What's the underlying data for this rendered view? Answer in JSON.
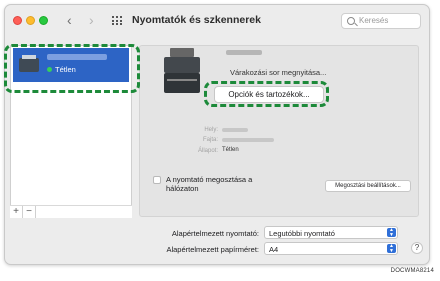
{
  "window": {
    "title": "Nyomtatók és szkennerek",
    "search_placeholder": "Keresés"
  },
  "sidebar": {
    "items": [
      {
        "status": "Tétlen"
      }
    ],
    "add_label": "+",
    "remove_label": "−"
  },
  "detail": {
    "queue_text": "Várakozási sor megnyitása...",
    "options_button": "Opciók és tartozékok...",
    "location_label": "Hely:",
    "kind_label": "Fajta:",
    "status_label": "Állapot:",
    "status_value": "Tétlen",
    "share_label": "A nyomtató megosztása a hálózaton",
    "share_settings_button": "Megosztási beállítások..."
  },
  "defaults": {
    "printer_label": "Alapértelmezett nyomtató:",
    "printer_value": "Legutóbbi nyomtató",
    "paper_label": "Alapértelmezett papírméret:",
    "paper_value": "A4"
  },
  "help_label": "?",
  "figure_code": "DOCWMA8214",
  "colors": {
    "selection": "#2d64c5",
    "highlight_dash": "#1d8a3a",
    "status_dot": "#36d05a"
  },
  "icons": [
    "chevron-left-icon",
    "chevron-right-icon",
    "grid-icon",
    "search-icon",
    "printer-icon",
    "help-icon"
  ]
}
